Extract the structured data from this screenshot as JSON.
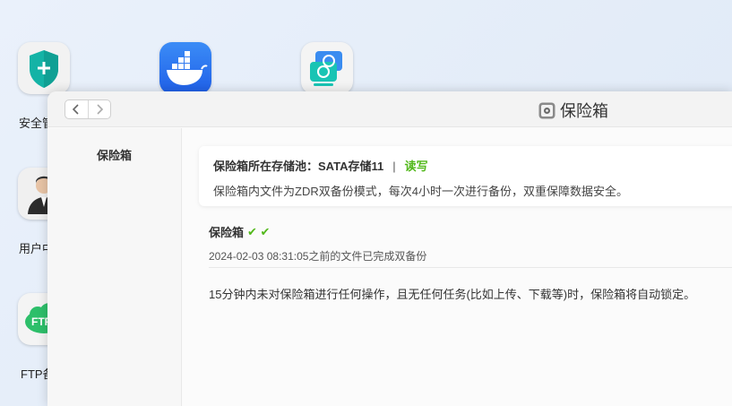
{
  "desktop": {
    "icons": [
      {
        "name": "security-app",
        "label": "安全管"
      },
      {
        "name": "docker-app",
        "label": ""
      },
      {
        "name": "sync-app",
        "label": ""
      },
      {
        "name": "user-app",
        "label": "用户中"
      },
      {
        "name": "ftp-app",
        "label": "FTP备",
        "badge": "FTP"
      }
    ]
  },
  "window": {
    "title": "保险箱",
    "sidebar": {
      "items": [
        {
          "label": "保险箱"
        }
      ]
    },
    "info_card": {
      "pool_label": "保险箱所在存储池：SATA存储11",
      "separator": "|",
      "mode": "读写",
      "description": "保险箱内文件为ZDR双备份模式，每次4小时一次进行备份，双重保障数据安全。"
    },
    "section": {
      "title": "保险箱",
      "checks": "✔ ✔",
      "backup_status": "2024-02-03 08:31:05之前的文件已完成双备份",
      "lock_note": "15分钟内未对保险箱进行任何操作，且无任何任务(比如上传、下载等)时，保险箱将自动锁定。"
    }
  },
  "colors": {
    "accent_green": "#52b81b",
    "docker_blue": "#1f5fe8",
    "shield_teal": "#14b3a6"
  }
}
